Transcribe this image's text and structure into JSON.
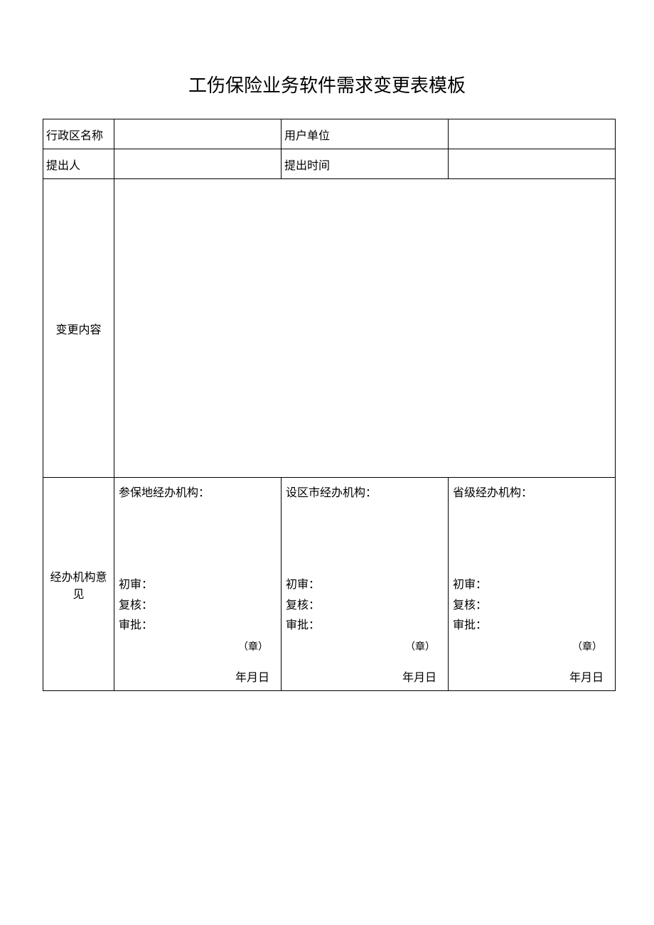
{
  "title": "工伤保险业务软件需求变更表模板",
  "fields": {
    "region_label": "行政区名称",
    "region_value": "",
    "unit_label": "用户单位",
    "unit_value": "",
    "proposer_label": "提出人",
    "proposer_value": "",
    "propose_time_label": "提出时间",
    "propose_time_value": "",
    "change_content_label": "变更内容",
    "change_content_value": "",
    "opinion_label": "经办机构意见"
  },
  "opinions": [
    {
      "header": "参保地经办机构：",
      "first_review": "初审：",
      "recheck": "复核：",
      "approve": "审批：",
      "stamp": "（章）",
      "date": "年月日"
    },
    {
      "header": "设区市经办机构：",
      "first_review": "初审：",
      "recheck": "复核：",
      "approve": "审批：",
      "stamp": "（章）",
      "date": "年月日"
    },
    {
      "header": "省级经办机构：",
      "first_review": "初审：",
      "recheck": "复核：",
      "approve": "审批：",
      "stamp": "（章）",
      "date": "年月日"
    }
  ]
}
